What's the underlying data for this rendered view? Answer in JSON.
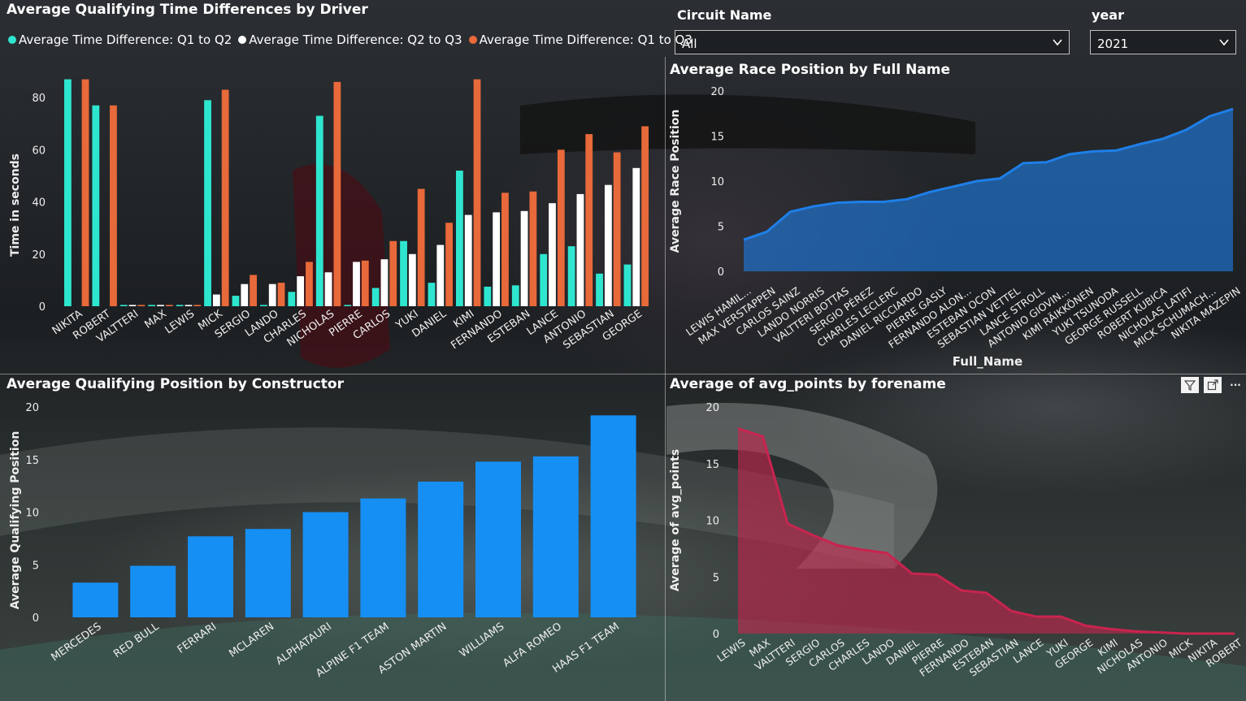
{
  "slicers": {
    "circuit_label": "Circuit Name",
    "circuit_value": "All",
    "year_label": "year",
    "year_value": "2021"
  },
  "panel_icons": [
    "filter-icon",
    "focus-mode-icon",
    "more-options-icon"
  ],
  "chart_data": [
    {
      "id": "quali_diff",
      "type": "bar",
      "title": "Average Qualifying Time Differences by Driver",
      "xlabel": "",
      "ylabel": "Time in seconds",
      "ylim": [
        0,
        90
      ],
      "yticks": [
        0,
        20,
        40,
        60,
        80
      ],
      "legend_position": "top-left",
      "categories": [
        "NIKITA",
        "ROBERT",
        "VALTTERI",
        "MAX",
        "LEWIS",
        "MICK",
        "SERGIO",
        "LANDO",
        "CHARLES",
        "NICHOLAS",
        "PIERRE",
        "CARLOS",
        "YUKI",
        "DANIEL",
        "KIMI",
        "FERNANDO",
        "ESTEBAN",
        "LANCE",
        "ANTONIO",
        "SEBASTIAN",
        "GEORGE"
      ],
      "series": [
        {
          "name": "Average Time Difference: Q1 to Q2",
          "color": "#2ee6cf",
          "values": [
            87,
            77,
            0.5,
            0.5,
            0.5,
            79,
            4,
            0.5,
            5.5,
            73,
            0.5,
            7,
            25,
            9,
            52,
            7.5,
            8,
            20,
            23,
            12.5,
            16
          ]
        },
        {
          "name": "Average Time Difference: Q2 to Q3",
          "color": "#ffffff",
          "values": [
            0,
            0,
            0.5,
            0.5,
            0.5,
            4.5,
            8.5,
            8.5,
            11.5,
            13,
            17,
            18,
            20,
            23.5,
            35,
            36,
            36.5,
            39.5,
            43,
            46.5,
            53
          ]
        },
        {
          "name": "Average Time Difference: Q1 to Q3",
          "color": "#e8693a",
          "values": [
            87,
            77,
            0.5,
            0.5,
            0.5,
            83,
            12,
            9,
            17,
            86,
            17.5,
            25,
            45,
            32,
            87,
            43.5,
            44,
            60,
            66,
            59,
            69
          ]
        }
      ]
    },
    {
      "id": "race_pos",
      "type": "area",
      "title": "Average Race Position by Full Name",
      "xlabel": "Full_Name",
      "ylabel": "Average Race Position",
      "ylim": [
        0,
        20
      ],
      "yticks": [
        0,
        5,
        10,
        15,
        20
      ],
      "color": "#1e7fe8",
      "categories": [
        "LEWIS HAMIL...",
        "MAX VERSTAPPEN",
        "CARLOS SAINZ",
        "LANDO NORRIS",
        "VALTTERI BOTTAS",
        "SERGIO PÉREZ",
        "CHARLES LECLERC",
        "DANIEL RICCIARDO",
        "PIERRE GASLY",
        "FERNANDO ALON...",
        "ESTEBAN OCON",
        "SEBASTIAN VETTEL",
        "LANCE STROLL",
        "ANTONIO GIOVIN...",
        "KIMI RÄIKKÖNEN",
        "YUKI TSUNODA",
        "GEORGE RUSSELL",
        "ROBERT KUBICA",
        "NICHOLAS LATIFI",
        "MICK SCHUMACH...",
        "NIKITA MAZEPIN"
      ],
      "values": [
        3.5,
        4.4,
        6.6,
        7.2,
        7.6,
        7.7,
        7.7,
        8.0,
        8.8,
        9.4,
        10.0,
        10.3,
        12.0,
        12.1,
        13.0,
        13.3,
        13.4,
        14.1,
        14.7,
        15.7,
        17.2,
        18.0
      ]
    },
    {
      "id": "quali_pos_constructor",
      "type": "bar",
      "title": "Average Qualifying Position by Constructor",
      "xlabel": "",
      "ylabel": "Average Qualifying Position",
      "ylim": [
        0,
        20
      ],
      "yticks": [
        0,
        5,
        10,
        15,
        20
      ],
      "color": "#168ff5",
      "categories": [
        "MERCEDES",
        "RED BULL",
        "FERRARI",
        "MCLAREN",
        "ALPHATAURI",
        "ALPINE F1 TEAM",
        "ASTON MARTIN",
        "WILLIAMS",
        "ALFA ROMEO",
        "HAAS F1 TEAM"
      ],
      "values": [
        3.3,
        4.9,
        7.7,
        8.4,
        10.0,
        11.3,
        12.9,
        14.8,
        15.3,
        19.2
      ]
    },
    {
      "id": "avg_points",
      "type": "area",
      "title": "Average of avg_points by forename",
      "xlabel": "",
      "ylabel": "Average of avg_points",
      "ylim": [
        0,
        20
      ],
      "yticks": [
        0,
        5,
        10,
        15,
        20
      ],
      "color": "#c8244f",
      "categories": [
        "LEWIS",
        "MAX",
        "VALTTERI",
        "SERGIO",
        "CARLOS",
        "CHARLES",
        "LANDO",
        "DANIEL",
        "PIERRE",
        "FERNANDO",
        "ESTEBAN",
        "SEBASTIAN",
        "LANCE",
        "YUKI",
        "GEORGE",
        "KIMI",
        "NICHOLAS",
        "ANTONIO",
        "MICK",
        "NIKITA",
        "ROBERT"
      ],
      "values": [
        18.1,
        17.4,
        9.7,
        8.7,
        7.8,
        7.4,
        7.1,
        5.3,
        5.2,
        3.8,
        3.6,
        2.0,
        1.5,
        1.5,
        0.7,
        0.4,
        0.2,
        0.1,
        0,
        0,
        0
      ]
    }
  ]
}
